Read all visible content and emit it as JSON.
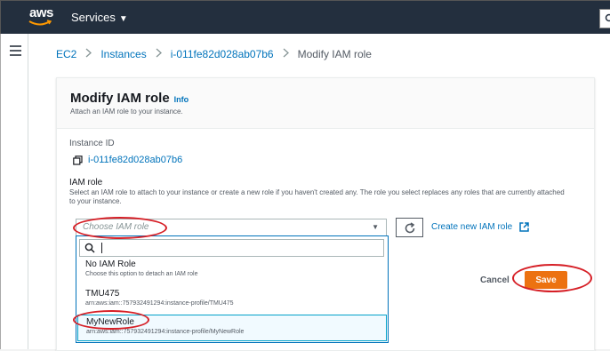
{
  "nav": {
    "logo_text": "aws",
    "services_label": "Services",
    "services_caret": "▼"
  },
  "breadcrumb": [
    {
      "label": "EC2"
    },
    {
      "label": "Instances"
    },
    {
      "label": "i-011fe82d028ab07b6"
    },
    {
      "label": "Modify IAM role"
    }
  ],
  "breadcrumb_separator": ">",
  "card": {
    "title": "Modify IAM role",
    "info_link": "Info",
    "subtitle": "Attach an IAM role to your instance."
  },
  "instance": {
    "label": "Instance ID",
    "value": "i-011fe82d028ab07b6"
  },
  "iam": {
    "label": "IAM role",
    "description": "Select an IAM role to attach to your instance or create a new role if you haven't created any. The role you select replaces any roles that are currently attached to your instance.",
    "placeholder": "Choose IAM role",
    "create_link": "Create new IAM role"
  },
  "dropdown": {
    "search_value": "",
    "options": [
      {
        "name": "No IAM Role",
        "detail": "Choose this option to detach an IAM role"
      },
      {
        "name": "TMU475",
        "detail": "arn:aws:iam::757932491294:instance-profile/TMU475"
      },
      {
        "name": "MyNewRole",
        "detail": "arn:aws:iam::757932491294:instance-profile/MyNewRole",
        "highlighted": true
      }
    ]
  },
  "actions": {
    "cancel": "Cancel",
    "save": "Save"
  },
  "colors": {
    "nav_bg": "#232f3e",
    "link": "#0073bb",
    "save": "#ec7211",
    "annotation": "#d61f26"
  }
}
